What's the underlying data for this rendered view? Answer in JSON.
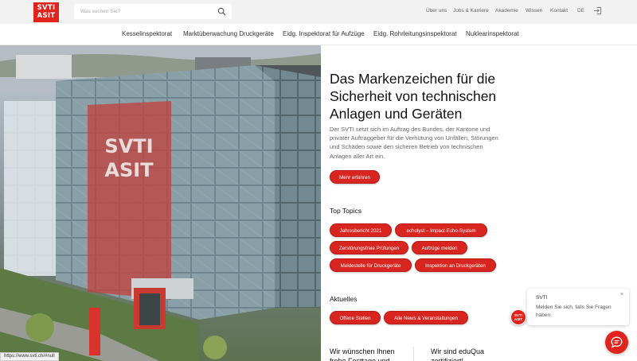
{
  "header": {
    "logo_line1": "SVTI",
    "logo_line2": "ASIT",
    "search_placeholder": "Was suchen Sie?",
    "util_links": [
      "Über uns",
      "Jobs & Karriere",
      "Akademie",
      "Wissen",
      "Kontakt"
    ],
    "language": "DE"
  },
  "main_nav": [
    "Kesselinspektorat",
    "Marktüberwachung Druckgeräte",
    "Eidg. Inspektorat für Aufzüge",
    "Eidg. Rohrleitungsinspektorat",
    "Nuklearinspektorat"
  ],
  "hero": {
    "title": "Das Markenzeichen für die Sicherheit von technischen Anlagen und Geräten",
    "intro": "Der SVTI setzt sich im Auftrag des Bundes, der Kantone und privater Auftraggeber für die Verhütung von Unfällen, Störungen und Schäden sowie den sicheren Betrieb von technischen Anlagen aller Art ein.",
    "cta": "Mehr erfahren",
    "building_sign_line1": "SVTI",
    "building_sign_line2": "ASIT"
  },
  "top_topics": {
    "title": "Top Topics",
    "items": [
      "Jahresbericht 2021",
      "echolyst – Impact-Echo-System",
      "Zerstörungsfreie Prüfungen",
      "Aufzüge melden",
      "Meldestelle für Druckgeräte",
      "Inspektion an Druckgeräten"
    ]
  },
  "news": {
    "title": "Aktuelles",
    "buttons": [
      "Offene Stellen",
      "Alle News & Veranstaltungen"
    ],
    "teaser1": "Wir wünschen Ihnen frohe Festtage und",
    "teaser2": "Wir sind eduQua zertifiziert!"
  },
  "chat": {
    "title": "SVTI",
    "message": "Melden Sie sich, falls Sie Fragen haben.",
    "close": "×",
    "avatar_line1": "SVTI",
    "avatar_line2": "ASIT"
  },
  "status_url": "https://www.svti.ch/#null",
  "colors": {
    "brand_red": "#d9251f",
    "topbar_bg": "#f2f2f2"
  },
  "icons": [
    "search-icon",
    "login-icon",
    "chat-bubble-icon"
  ]
}
